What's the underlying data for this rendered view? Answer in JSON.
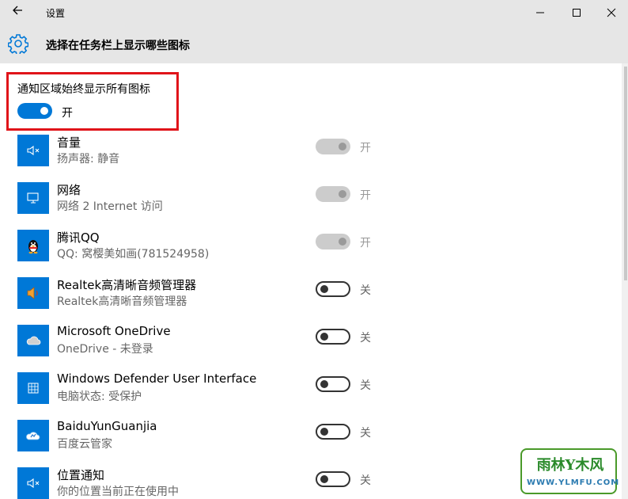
{
  "window": {
    "title": "设置"
  },
  "header": {
    "title": "选择在任务栏上显示哪些图标"
  },
  "master": {
    "label": "通知区域始终显示所有图标",
    "state": "开"
  },
  "rows": [
    {
      "icon": "speaker-muted-icon",
      "name": "音量",
      "desc": "扬声器: 静音",
      "toggle": "disabled",
      "state": "开"
    },
    {
      "icon": "network-icon",
      "name": "网络",
      "desc": "网络  2 Internet 访问",
      "toggle": "disabled",
      "state": "开"
    },
    {
      "icon": "penguin-qq-icon",
      "name": "腾讯QQ",
      "desc": "QQ: 窝樱美如画(781524958)",
      "toggle": "disabled",
      "state": "开"
    },
    {
      "icon": "speaker-icon",
      "name": "Realtek高清晰音频管理器",
      "desc": "Realtek高清晰音频管理器",
      "toggle": "off",
      "state": "关"
    },
    {
      "icon": "cloud-icon",
      "name": "Microsoft OneDrive",
      "desc": "OneDrive - 未登录",
      "toggle": "off",
      "state": "关"
    },
    {
      "icon": "defender-icon",
      "name": "Windows Defender User Interface",
      "desc": "电脑状态: 受保护",
      "toggle": "off",
      "state": "关"
    },
    {
      "icon": "baidu-cloud-icon",
      "name": "BaiduYunGuanjia",
      "desc": "百度云管家",
      "toggle": "off",
      "state": "关"
    },
    {
      "icon": "location-muted-icon",
      "name": "位置通知",
      "desc": "你的位置当前正在使用中",
      "toggle": "off",
      "state": "关"
    }
  ],
  "watermark": {
    "main": "雨林Y木风",
    "sub": "WWW.YLMFU.COM"
  },
  "colors": {
    "accent": "#0078d7",
    "highlight": "#e0141a",
    "chrome": "#e6e6e6"
  }
}
